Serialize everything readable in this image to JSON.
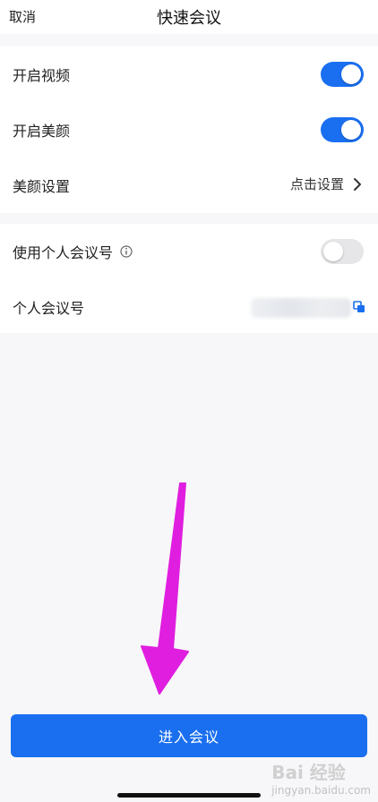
{
  "header": {
    "cancel_label": "取消",
    "title": "快速会议"
  },
  "settings": {
    "video": {
      "label": "开启视频",
      "enabled": true
    },
    "beauty": {
      "label": "开启美颜",
      "enabled": true
    },
    "beauty_settings": {
      "label": "美颜设置",
      "value": "点击设置"
    }
  },
  "personal": {
    "use_personal_id": {
      "label": "使用个人会议号",
      "enabled": false
    },
    "personal_id": {
      "label": "个人会议号"
    }
  },
  "footer": {
    "enter_button": "进入会议"
  },
  "watermark": {
    "main": "Bai 经验",
    "sub": "jingyan.baidu.com"
  },
  "colors": {
    "accent": "#1a6ff0",
    "annotation_arrow": "#e01ee0"
  }
}
